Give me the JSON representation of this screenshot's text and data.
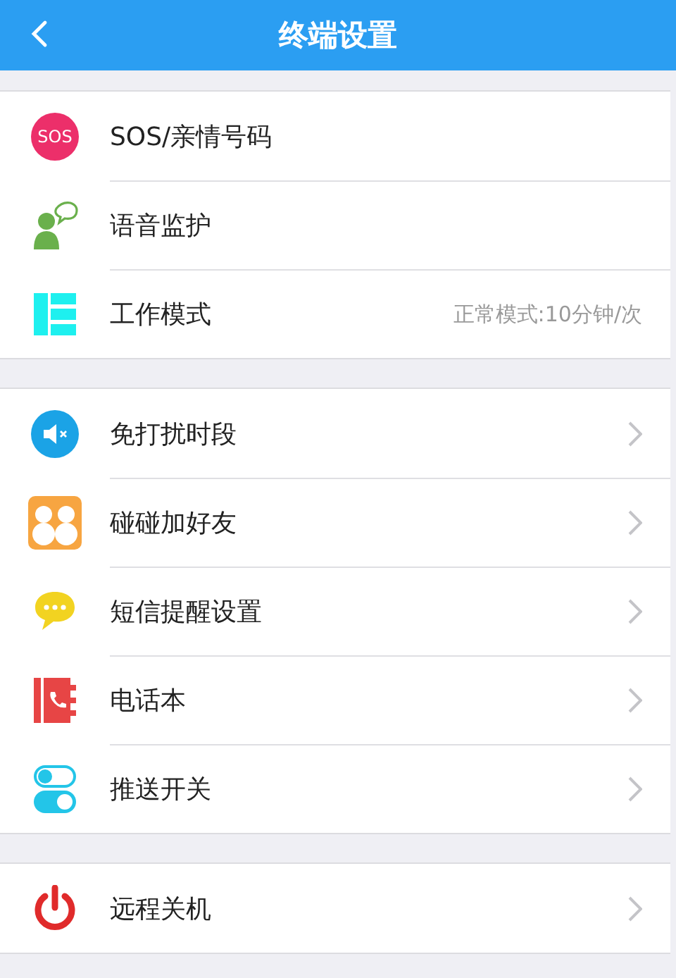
{
  "header": {
    "title": "终端设置"
  },
  "sections": [
    {
      "items": [
        {
          "kind": "sos",
          "icon_text": "SOS",
          "label": "SOS/亲情号码",
          "chevron": false
        },
        {
          "kind": "voice",
          "label": "语音监护",
          "chevron": false
        },
        {
          "kind": "mode",
          "label": "工作模式",
          "value": "正常模式:10分钟/次",
          "chevron": false
        }
      ]
    },
    {
      "items": [
        {
          "kind": "mute",
          "label": "免打扰时段",
          "chevron": true
        },
        {
          "kind": "friends",
          "label": "碰碰加好友",
          "chevron": true
        },
        {
          "kind": "message",
          "label": "短信提醒设置",
          "chevron": true
        },
        {
          "kind": "phonebook",
          "label": "电话本",
          "chevron": true
        },
        {
          "kind": "switch",
          "label": "推送开关",
          "chevron": true
        }
      ]
    },
    {
      "items": [
        {
          "kind": "power",
          "label": "远程关机",
          "chevron": true
        }
      ]
    }
  ]
}
